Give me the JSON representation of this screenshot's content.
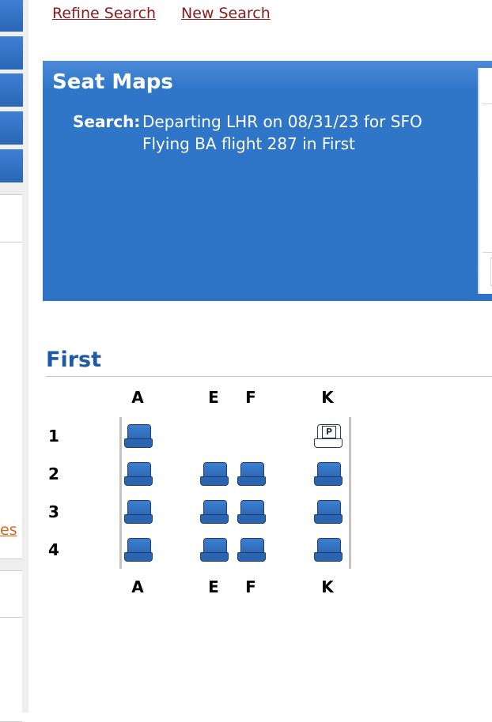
{
  "top_links": {
    "refine": "Refine Search",
    "new": "New Search"
  },
  "header": {
    "title": "Seat Maps",
    "search_label": "Search:",
    "line1": "Departing LHR on 08/31/23 for SFO",
    "line2": "Flying BA flight 287 in First"
  },
  "sidebar": {
    "link_fragment": "es"
  },
  "cabin": {
    "name": "First",
    "columns": [
      "A",
      "E",
      "F",
      "K"
    ],
    "rows": [
      "1",
      "2",
      "3",
      "4"
    ],
    "seat_map": [
      [
        "available",
        "none",
        "none",
        "premium"
      ],
      [
        "available",
        "available",
        "available",
        "available"
      ],
      [
        "available",
        "available",
        "available",
        "available"
      ],
      [
        "available",
        "available",
        "available",
        "available"
      ]
    ],
    "premium_seat_symbol": "P"
  },
  "colors": {
    "header_blue": "#2d73c5",
    "seat_blue": "#2a63b0",
    "cabin_title": "#1f5aa6",
    "link_red": "#8b1a1a"
  }
}
